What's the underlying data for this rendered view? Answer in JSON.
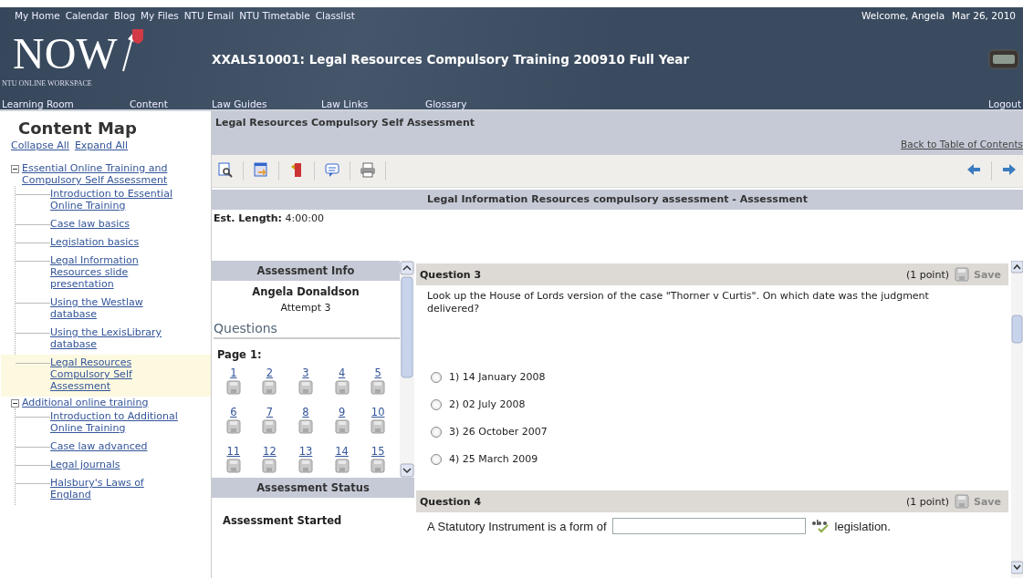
{
  "top_links": [
    "My Home",
    "Calendar",
    "Blog",
    "My Files",
    "NTU Email",
    "NTU Timetable",
    "Classlist"
  ],
  "welcome": "Welcome, Angela",
  "date": "Mar 26, 2010",
  "logo": {
    "text": "NOW",
    "subtitle": "NTU ONLINE WORKSPACE"
  },
  "course_title": "XXALS10001: Legal Resources Compulsory Training 200910 Full Year",
  "nav": [
    "Learning Room",
    "Content",
    "Law Guides",
    "Law Links",
    "Glossary"
  ],
  "logout": "Logout",
  "sidebar": {
    "title": "Content Map",
    "actions": [
      "Collapse All",
      "Expand All"
    ],
    "tree": [
      {
        "label": "Essential Online Training and Compulsory Self Assessment",
        "expanded": true,
        "selected": false,
        "children": [
          {
            "label": "Introduction to Essential Online Training",
            "selected": false
          },
          {
            "label": "Case law basics",
            "selected": false
          },
          {
            "label": "Legislation basics",
            "selected": false
          },
          {
            "label": "Legal Information Resources slide presentation",
            "selected": false
          },
          {
            "label": "Using the Westlaw database",
            "selected": false
          },
          {
            "label": "Using the LexisLibrary database",
            "selected": false
          },
          {
            "label": "Legal Resources Compulsory Self Assessment",
            "selected": true
          }
        ]
      },
      {
        "label": "Additional online training",
        "expanded": true,
        "selected": false,
        "children": [
          {
            "label": "Introduction to Additional Online Training",
            "selected": false
          },
          {
            "label": "Case law advanced",
            "selected": false
          },
          {
            "label": "Legal journals",
            "selected": false
          },
          {
            "label": "Halsbury's Laws of England",
            "selected": false
          }
        ]
      }
    ]
  },
  "page_title": "Legal Resources Compulsory Self Assessment",
  "back_link": "Back to Table of Contents",
  "section_title": "Legal Information Resources compulsory assessment - Assessment",
  "est_length": {
    "label": "Est. Length:",
    "value": "4:00:00"
  },
  "info": {
    "title": "Assessment Info",
    "name": "Angela Donaldson",
    "attempt": "Attempt 3",
    "questions_title": "Questions",
    "page_label": "Page 1:",
    "numbers": [
      "1",
      "2",
      "3",
      "4",
      "5",
      "6",
      "7",
      "8",
      "9",
      "10",
      "11",
      "12",
      "13",
      "14",
      "15"
    ],
    "status_title": "Assessment Status",
    "status": "Assessment Started"
  },
  "questions": [
    {
      "kind": "choice",
      "title": "Question 3",
      "points": "(1 point)",
      "save": "Save",
      "text": "Look up the House of Lords version of the case \"Thorner v Curtis\".  On which date was the judgment delivered?",
      "options": [
        {
          "label": "1)  14 January 2008",
          "selected": false
        },
        {
          "label": "2)  02 July 2008",
          "selected": false
        },
        {
          "label": "3)  26 October 2007",
          "selected": false
        },
        {
          "label": "4)  25 March 2009",
          "selected": false
        }
      ]
    },
    {
      "kind": "fill",
      "title": "Question 4",
      "points": "(1 point)",
      "save": "Save",
      "before": "A Statutory Instrument is a form of",
      "after": "legislation."
    }
  ]
}
